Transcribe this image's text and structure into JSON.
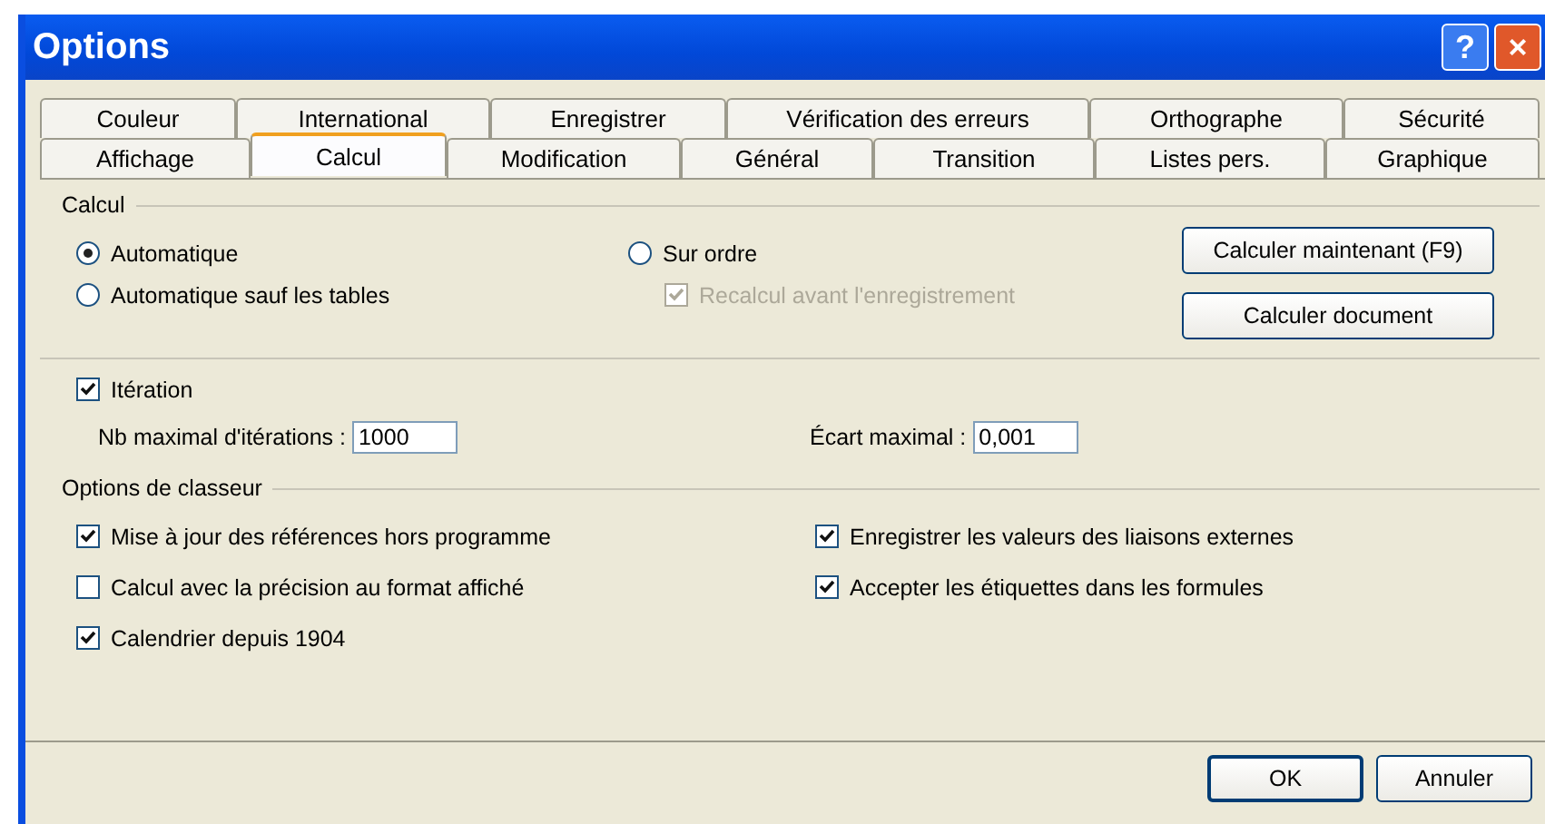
{
  "window": {
    "title": "Options",
    "title_buttons": [
      "?",
      "×"
    ]
  },
  "tab_rows": [
    {
      "tabs": [
        {
          "label": "Couleur",
          "selected": false
        },
        {
          "label": "International",
          "selected": false
        },
        {
          "label": "Enregistrer",
          "selected": false
        },
        {
          "label": "Vérification des erreurs",
          "selected": false
        },
        {
          "label": "Orthographe",
          "selected": false
        },
        {
          "label": "Sécurité",
          "selected": false
        }
      ]
    },
    {
      "tabs": [
        {
          "label": "Affichage",
          "selected": false
        },
        {
          "label": "Calcul",
          "selected": true
        },
        {
          "label": "Modification",
          "selected": false
        },
        {
          "label": "Général",
          "selected": false
        },
        {
          "label": "Transition",
          "selected": false
        },
        {
          "label": "Listes pers.",
          "selected": false
        },
        {
          "label": "Graphique",
          "selected": false
        }
      ]
    }
  ],
  "calcul": {
    "title": "Calcul",
    "modes": [
      {
        "label": "Automatique",
        "selected": true
      },
      {
        "label": "Automatique sauf les tables",
        "selected": false
      },
      {
        "label": "Sur ordre",
        "selected": false
      }
    ],
    "recalc": {
      "label": "Recalcul avant l'enregistrement",
      "checked": true,
      "disabled": true
    },
    "buttons": [
      "Calculer maintenant (F9)",
      "Calculer document"
    ]
  },
  "iteration": {
    "label": "Itération",
    "checked": true,
    "fields": [
      {
        "label": "Nb maximal d'itérations :",
        "value": "1000"
      },
      {
        "label": "Écart maximal :",
        "value": "0,001"
      }
    ]
  },
  "workbook": {
    "title": "Options de classeur",
    "options": [
      {
        "label": "Mise à jour des références hors programme",
        "checked": true
      },
      {
        "label": "Enregistrer les valeurs des liaisons externes",
        "checked": true
      },
      {
        "label": "Calcul avec la précision au format affiché",
        "checked": false
      },
      {
        "label": "Accepter les étiquettes dans les formules",
        "checked": true
      },
      {
        "label": "Calendrier depuis 1904",
        "checked": true
      }
    ]
  },
  "footer_buttons": [
    "OK",
    "Annuler"
  ]
}
